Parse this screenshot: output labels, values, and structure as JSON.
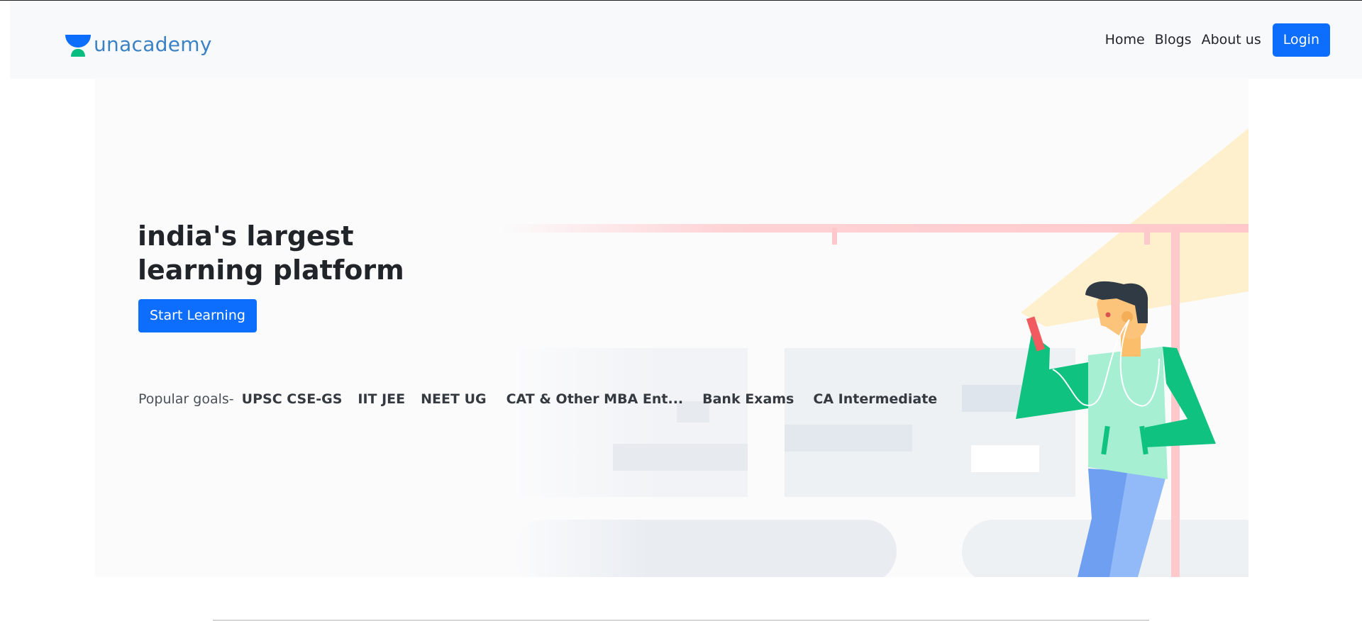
{
  "navbar": {
    "brand": "unacademy",
    "links": [
      "Home",
      "Blogs",
      "About us"
    ],
    "login_label": "Login"
  },
  "hero": {
    "title_line1": "india's largest",
    "title_line2": "learning platform",
    "cta_label": "Start Learning",
    "popular_label": "Popular goals-",
    "goals": [
      "UPSC CSE-GS",
      "IIT JEE",
      "NEET UG",
      "CAT & Other MBA Ent...",
      "Bank Exams",
      "CA Intermediate"
    ]
  },
  "colors": {
    "primary": "#0d6efd",
    "brand_blue": "#3b82c4",
    "brand_green": "#08bd80",
    "navbar_bg": "#f8f9fa",
    "hero_bg": "#fbfbfc"
  }
}
